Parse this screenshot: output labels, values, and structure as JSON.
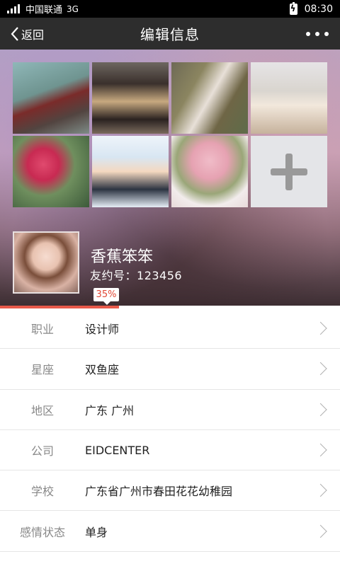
{
  "status_bar": {
    "carrier": "中国联通",
    "network": "3G",
    "time": "08:30"
  },
  "nav": {
    "back_label": "返回",
    "title": "编辑信息"
  },
  "profile": {
    "name": "香蕉笨笨",
    "uid_label": "友约号：",
    "uid_value": "123456"
  },
  "progress": {
    "text": "35%",
    "value": 0.35,
    "color": "#e8594a"
  },
  "info": [
    {
      "label": "职业",
      "value": "设计师"
    },
    {
      "label": "星座",
      "value": "双鱼座"
    },
    {
      "label": "地区",
      "value": "广东 广州"
    },
    {
      "label": "公司",
      "value": "EIDCENTER"
    },
    {
      "label": "学校",
      "value": "广东省广州市春田花花幼稚园"
    },
    {
      "label": "感情状态",
      "value": "单身"
    }
  ],
  "icons": {
    "back": "chevron-left-icon",
    "more": "more-dots-icon",
    "add_photo": "plus-icon",
    "row_arrow": "chevron-right-icon"
  }
}
